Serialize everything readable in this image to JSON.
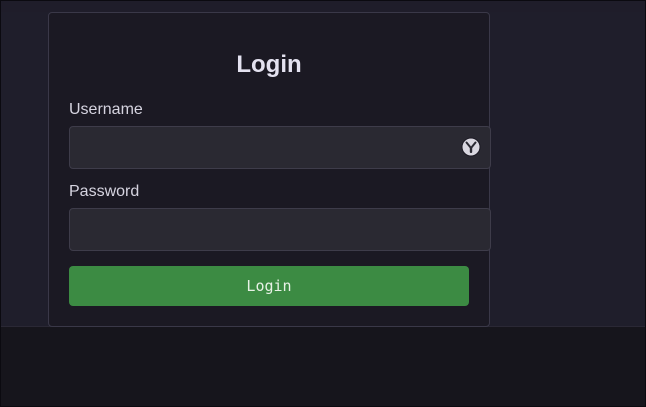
{
  "login_form": {
    "title": "Login",
    "username_label": "Username",
    "username_value": "",
    "password_label": "Password",
    "password_value": "",
    "submit_label": "Login",
    "password_manager_icon": "key-icon"
  },
  "colors": {
    "background": "#1f1e2b",
    "card_background": "#1b1923",
    "input_background": "#2a2932",
    "primary_button": "#3c8b43",
    "text": "#e4e2f0"
  }
}
